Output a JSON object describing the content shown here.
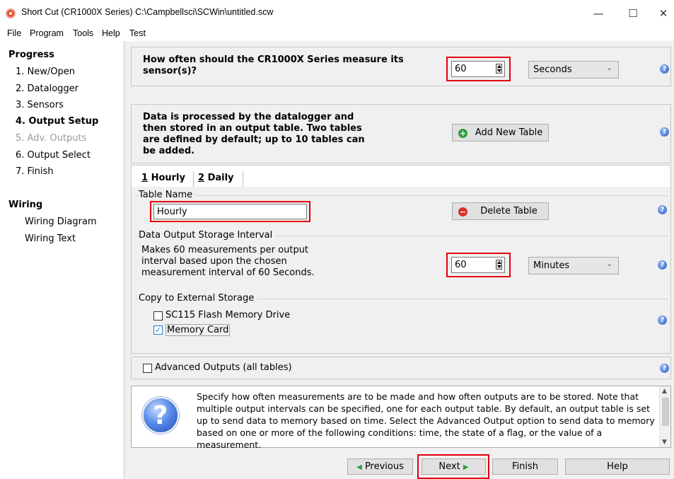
{
  "window": {
    "title": "Short Cut (CR1000X Series) C:\\Campbellsci\\SCWin\\untitled.scw",
    "minimize": "—",
    "maximize": "☐",
    "close": "✕"
  },
  "menu": {
    "file": "File",
    "program": "Program",
    "tools": "Tools",
    "help": "Help",
    "test": "Test"
  },
  "sidebar": {
    "progress_heading": "Progress",
    "steps": [
      {
        "label": "1. New/Open",
        "state": "normal"
      },
      {
        "label": "2. Datalogger",
        "state": "normal"
      },
      {
        "label": "3. Sensors",
        "state": "normal"
      },
      {
        "label": "4. Output Setup",
        "state": "active"
      },
      {
        "label": "5. Adv. Outputs",
        "state": "disabled"
      },
      {
        "label": "6. Output Select",
        "state": "normal"
      },
      {
        "label": "7. Finish",
        "state": "normal"
      }
    ],
    "wiring_heading": "Wiring",
    "wiring_items": [
      "Wiring Diagram",
      "Wiring Text"
    ]
  },
  "measure": {
    "question": "How often should the CR1000X Series measure its sensor(s)?",
    "value": "60",
    "unit": "Seconds"
  },
  "tables": {
    "description": "Data is processed by the datalogger and then stored in an output table. Two tables are defined by default; up to 10 tables can be added.",
    "add_button": "Add New Table",
    "tabs": [
      {
        "key": "1",
        "label": " Hourly"
      },
      {
        "key": "2",
        "label": " Daily"
      }
    ]
  },
  "table_name": {
    "group_label": "Table Name",
    "value": "Hourly",
    "delete_button": "Delete Table"
  },
  "interval": {
    "group_label": "Data Output Storage Interval",
    "description": "Makes 60 measurements per output interval based upon the chosen measurement interval of 60 Seconds.",
    "value": "60",
    "unit": "Minutes"
  },
  "external": {
    "group_label": "Copy to External Storage",
    "options": [
      {
        "label": "SC115 Flash Memory Drive",
        "checked": false
      },
      {
        "label": "Memory Card",
        "checked": true
      }
    ]
  },
  "advanced": {
    "label": "Advanced Outputs (all tables)",
    "checked": false
  },
  "help_text": "Specify how often measurements are to be made and how often outputs are to be stored. Note that multiple output intervals can be specified, one for each output table. By default, an output table is set up to send data to memory based on time. Select the Advanced Output option to send data to memory based on one or more of the following conditions: time, the state of a flag, or the value of a measurement.",
  "footer": {
    "previous": "Previous",
    "next": "Next",
    "finish": "Finish",
    "help": "Help"
  },
  "colors": {
    "highlight_red": "#e3000f",
    "help_blue": "#2f5fc9",
    "add_green": "#2e9e3e",
    "delete_red": "#d9312b"
  },
  "icons": {
    "help": "?",
    "plus": "+",
    "minus": "−",
    "prev_arrow": "◀",
    "next_arrow": "▶",
    "chevron": "⌄",
    "check": "✓"
  }
}
